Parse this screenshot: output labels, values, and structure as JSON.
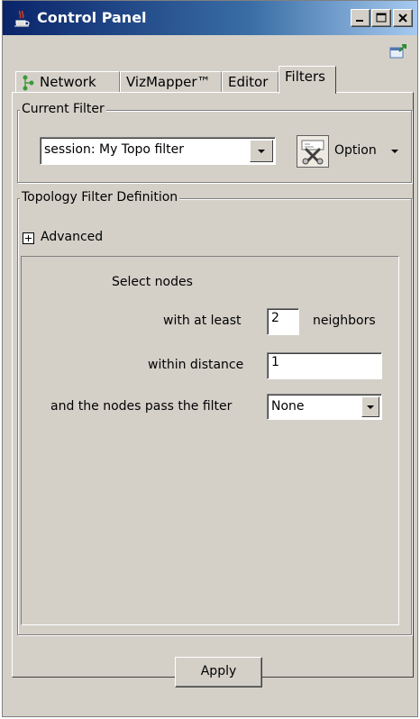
{
  "window": {
    "title": "Control Panel",
    "title_icon": "java-cup-icon",
    "controls": [
      "minimize-icon",
      "maximize-icon",
      "close-icon"
    ]
  },
  "toolbar": {
    "dock_icon": "dock-panel-icon"
  },
  "tabs": [
    {
      "label": "Network",
      "icon": "network-tree-icon",
      "active": false
    },
    {
      "label": "VizMapper™",
      "active": false
    },
    {
      "label": "Editor",
      "active": false
    },
    {
      "label": "Filters",
      "active": true
    }
  ],
  "current_filter": {
    "group_label": "Current Filter",
    "selected": "session: My Topo filter",
    "option_label": "Option",
    "option_icon": "filter-options-icon"
  },
  "topology": {
    "group_label": "Topology Filter Definition",
    "advanced_label": "Advanced",
    "select_nodes_label": "Select nodes",
    "min_neighbors_label": "with at least",
    "min_neighbors_value": "2",
    "neighbors_suffix": "neighbors",
    "distance_label": "within distance",
    "distance_value": "1",
    "pass_filter_label": "and the nodes pass the filter",
    "pass_filter_value": "None"
  },
  "apply_label": "Apply",
  "colors": {
    "titlebar_start": "#0a246a",
    "titlebar_end": "#a6caf0",
    "face": "#d4d0c8"
  }
}
